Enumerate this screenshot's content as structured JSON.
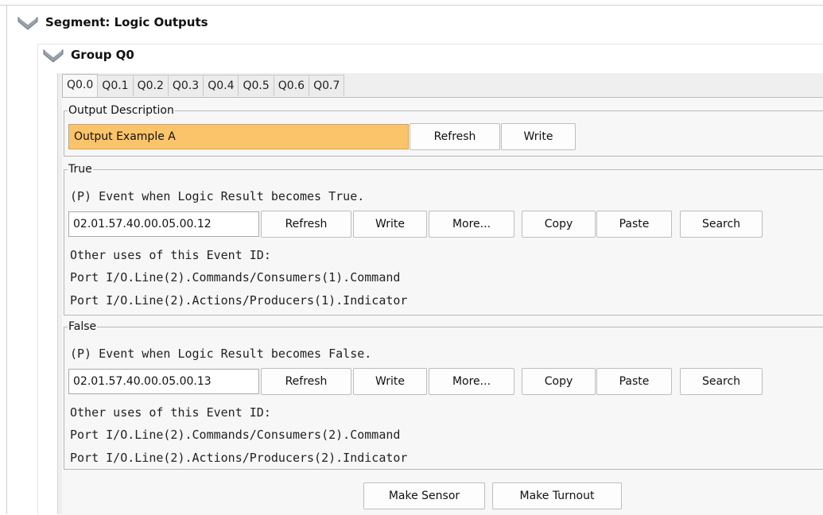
{
  "segment": {
    "title": "Segment: Logic Outputs"
  },
  "group": {
    "title": "Group Q0"
  },
  "tabs": [
    {
      "label": "Q0.0",
      "active": true
    },
    {
      "label": "Q0.1"
    },
    {
      "label": "Q0.2"
    },
    {
      "label": "Q0.3"
    },
    {
      "label": "Q0.4"
    },
    {
      "label": "Q0.5"
    },
    {
      "label": "Q0.6"
    },
    {
      "label": "Q0.7"
    }
  ],
  "output_description": {
    "legend": "Output Description",
    "value": "Output Example A",
    "refresh_label": "Refresh",
    "write_label": "Write",
    "highlight_color": "#fcc46a"
  },
  "true_event": {
    "legend": "True",
    "description": "(P) Event when Logic Result becomes True.",
    "event_id": "02.01.57.40.00.05.00.12",
    "refresh_label": "Refresh",
    "write_label": "Write",
    "more_label": "More...",
    "copy_label": "Copy",
    "paste_label": "Paste",
    "search_label": "Search",
    "other_uses_label": "Other uses of this Event ID:",
    "other_uses": [
      "Port I/O.Line(2).Commands/Consumers(1).Command",
      "Port I/O.Line(2).Actions/Producers(1).Indicator"
    ]
  },
  "false_event": {
    "legend": "False",
    "description": "(P) Event when Logic Result becomes False.",
    "event_id": "02.01.57.40.00.05.00.13",
    "refresh_label": "Refresh",
    "write_label": "Write",
    "more_label": "More...",
    "copy_label": "Copy",
    "paste_label": "Paste",
    "search_label": "Search",
    "other_uses_label": "Other uses of this Event ID:",
    "other_uses": [
      "Port I/O.Line(2).Commands/Consumers(2).Command",
      "Port I/O.Line(2).Actions/Producers(2).Indicator"
    ]
  },
  "actions": {
    "make_sensor_label": "Make Sensor",
    "make_turnout_label": "Make Turnout"
  }
}
